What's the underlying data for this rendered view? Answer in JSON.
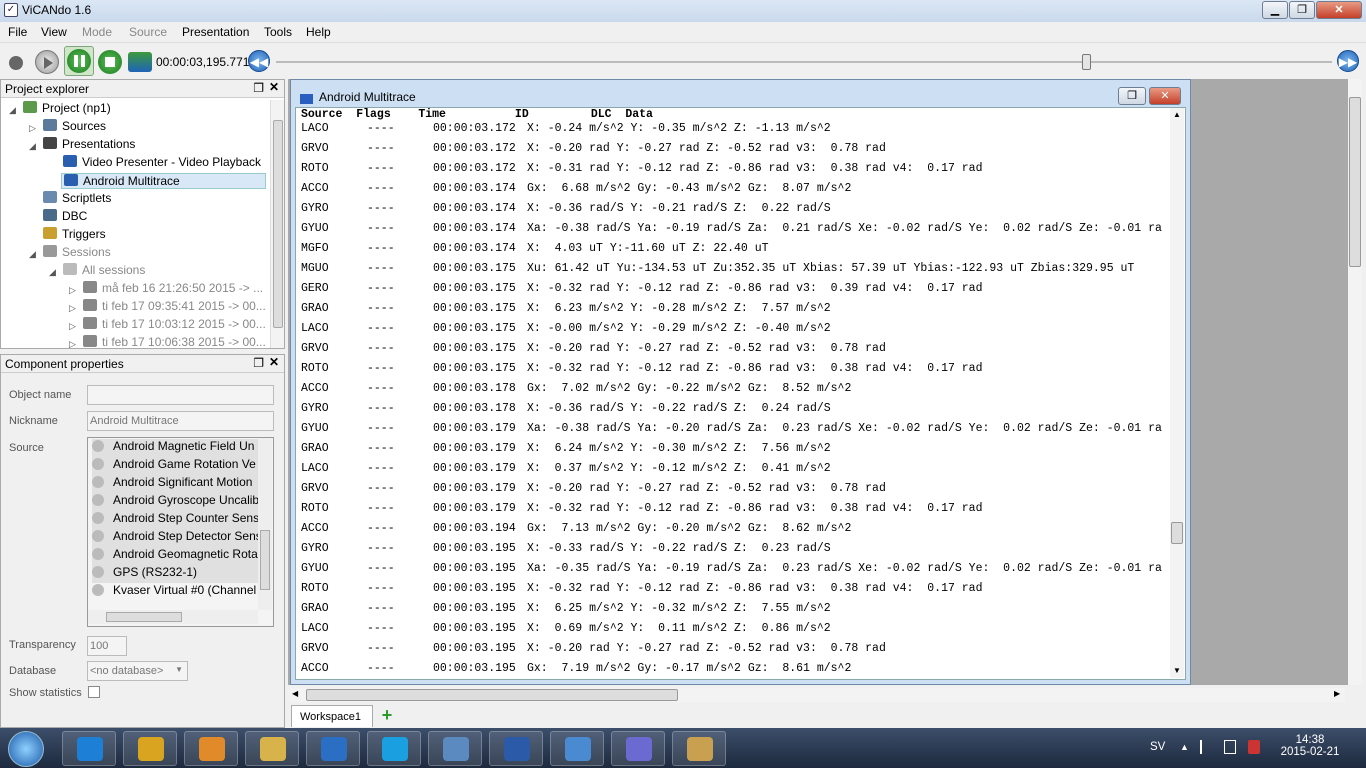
{
  "app": {
    "title": "ViCANdo 1.6"
  },
  "menu": [
    "File",
    "View",
    "Mode",
    "Source",
    "Presentation",
    "Tools",
    "Help"
  ],
  "toolbar": {
    "time": "00:00:03,195.771"
  },
  "project_explorer": {
    "title": "Project explorer",
    "items": [
      {
        "label": "Project (np1)",
        "indent": 0,
        "expander": "◢",
        "color": "#5a9a4a"
      },
      {
        "label": "Sources",
        "indent": 1,
        "expander": "▷",
        "color": "#5c7b9c"
      },
      {
        "label": "Presentations",
        "indent": 1,
        "expander": "◢",
        "color": "#444"
      },
      {
        "label": "Video Presenter - Video Playback",
        "indent": 2,
        "expander": "",
        "color": "#2a5fb0"
      },
      {
        "label": "Android Multitrace",
        "indent": 2,
        "expander": "",
        "color": "#2a5fb0",
        "selected": true
      },
      {
        "label": "Scriptlets",
        "indent": 1,
        "expander": "",
        "color": "#6a8ab0"
      },
      {
        "label": "DBC",
        "indent": 1,
        "expander": "",
        "color": "#4a6a8a"
      },
      {
        "label": "Triggers",
        "indent": 1,
        "expander": "",
        "color": "#c9a030"
      },
      {
        "label": "Sessions",
        "indent": 1,
        "expander": "◢",
        "color": "#999",
        "muted": true
      },
      {
        "label": "All sessions",
        "indent": 2,
        "expander": "◢",
        "color": "#bbb",
        "muted": true
      },
      {
        "label": "må feb 16 21:26:50 2015 -> ...",
        "indent": 3,
        "expander": "▷",
        "color": "#888",
        "muted": true
      },
      {
        "label": "ti feb 17 09:35:41 2015 -> 00...",
        "indent": 3,
        "expander": "▷",
        "color": "#888",
        "muted": true
      },
      {
        "label": "ti feb 17 10:03:12 2015 -> 00...",
        "indent": 3,
        "expander": "▷",
        "color": "#888",
        "muted": true
      },
      {
        "label": "ti feb 17 10:06:38 2015 -> 00...",
        "indent": 3,
        "expander": "▷",
        "color": "#888",
        "muted": true
      }
    ]
  },
  "component_properties": {
    "title": "Component properties",
    "object_name_label": "Object name",
    "object_name_value": "",
    "nickname_label": "Nickname",
    "nickname_value": "Android Multitrace",
    "source_label": "Source",
    "sources": [
      "Android Magnetic Field Un",
      "Android Game Rotation Ve",
      "Android Significant Motion",
      "Android Gyroscope Uncalib",
      "Android Step Counter Sens",
      "Android Step Detector Sens",
      "Android Geomagnetic Rota",
      "GPS (RS232-1)",
      "Kvaser Virtual #0 (Channel 0"
    ],
    "transparency_label": "Transparency",
    "transparency_value": "100",
    "database_label": "Database",
    "database_value": "<no database>",
    "show_statistics_label": "Show statistics"
  },
  "multitrace": {
    "title": "Android Multitrace",
    "header": "Source  Flags    Time          ID         DLC  Data",
    "rows": [
      [
        "LACO",
        "----",
        "00:00:03.172",
        "X: -0.24 m/s^2 Y: -0.35 m/s^2 Z: -1.13 m/s^2"
      ],
      [
        "GRVO",
        "----",
        "00:00:03.172",
        "X: -0.20 rad Y: -0.27 rad Z: -0.52 rad v3:  0.78 rad"
      ],
      [
        "ROTO",
        "----",
        "00:00:03.172",
        "X: -0.31 rad Y: -0.12 rad Z: -0.86 rad v3:  0.38 rad v4:  0.17 rad"
      ],
      [
        "ACCO",
        "----",
        "00:00:03.174",
        "Gx:  6.68 m/s^2 Gy: -0.43 m/s^2 Gz:  8.07 m/s^2"
      ],
      [
        "GYRO",
        "----",
        "00:00:03.174",
        "X: -0.36 rad/S Y: -0.21 rad/S Z:  0.22 rad/S"
      ],
      [
        "GYUO",
        "----",
        "00:00:03.174",
        "Xa: -0.38 rad/S Ya: -0.19 rad/S Za:  0.21 rad/S Xe: -0.02 rad/S Ye:  0.02 rad/S Ze: -0.01 ra"
      ],
      [
        "MGFO",
        "----",
        "00:00:03.174",
        "X:  4.03 uT Y:-11.60 uT Z: 22.40 uT"
      ],
      [
        "MGUO",
        "----",
        "00:00:03.175",
        "Xu: 61.42 uT Yu:-134.53 uT Zu:352.35 uT Xbias: 57.39 uT Ybias:-122.93 uT Zbias:329.95 uT"
      ],
      [
        "GERO",
        "----",
        "00:00:03.175",
        "X: -0.32 rad Y: -0.12 rad Z: -0.86 rad v3:  0.39 rad v4:  0.17 rad"
      ],
      [
        "GRAO",
        "----",
        "00:00:03.175",
        "X:  6.23 m/s^2 Y: -0.28 m/s^2 Z:  7.57 m/s^2"
      ],
      [
        "LACO",
        "----",
        "00:00:03.175",
        "X: -0.00 m/s^2 Y: -0.29 m/s^2 Z: -0.40 m/s^2"
      ],
      [
        "GRVO",
        "----",
        "00:00:03.175",
        "X: -0.20 rad Y: -0.27 rad Z: -0.52 rad v3:  0.78 rad"
      ],
      [
        "ROTO",
        "----",
        "00:00:03.175",
        "X: -0.32 rad Y: -0.12 rad Z: -0.86 rad v3:  0.38 rad v4:  0.17 rad"
      ],
      [
        "ACCO",
        "----",
        "00:00:03.178",
        "Gx:  7.02 m/s^2 Gy: -0.22 m/s^2 Gz:  8.52 m/s^2"
      ],
      [
        "GYRO",
        "----",
        "00:00:03.178",
        "X: -0.36 rad/S Y: -0.22 rad/S Z:  0.24 rad/S"
      ],
      [
        "GYUO",
        "----",
        "00:00:03.179",
        "Xa: -0.38 rad/S Ya: -0.20 rad/S Za:  0.23 rad/S Xe: -0.02 rad/S Ye:  0.02 rad/S Ze: -0.01 ra"
      ],
      [
        "GRAO",
        "----",
        "00:00:03.179",
        "X:  6.24 m/s^2 Y: -0.30 m/s^2 Z:  7.56 m/s^2"
      ],
      [
        "LACO",
        "----",
        "00:00:03.179",
        "X:  0.37 m/s^2 Y: -0.12 m/s^2 Z:  0.41 m/s^2"
      ],
      [
        "GRVO",
        "----",
        "00:00:03.179",
        "X: -0.20 rad Y: -0.27 rad Z: -0.52 rad v3:  0.78 rad"
      ],
      [
        "ROTO",
        "----",
        "00:00:03.179",
        "X: -0.32 rad Y: -0.12 rad Z: -0.86 rad v3:  0.38 rad v4:  0.17 rad"
      ],
      [
        "ACCO",
        "----",
        "00:00:03.194",
        "Gx:  7.13 m/s^2 Gy: -0.20 m/s^2 Gz:  8.62 m/s^2"
      ],
      [
        "GYRO",
        "----",
        "00:00:03.195",
        "X: -0.33 rad/S Y: -0.22 rad/S Z:  0.23 rad/S"
      ],
      [
        "GYUO",
        "----",
        "00:00:03.195",
        "Xa: -0.35 rad/S Ya: -0.19 rad/S Za:  0.23 rad/S Xe: -0.02 rad/S Ye:  0.02 rad/S Ze: -0.01 ra"
      ],
      [
        "ROTO",
        "----",
        "00:00:03.195",
        "X: -0.32 rad Y: -0.12 rad Z: -0.86 rad v3:  0.38 rad v4:  0.17 rad"
      ],
      [
        "GRAO",
        "----",
        "00:00:03.195",
        "X:  6.25 m/s^2 Y: -0.32 m/s^2 Z:  7.55 m/s^2"
      ],
      [
        "LACO",
        "----",
        "00:00:03.195",
        "X:  0.69 m/s^2 Y:  0.11 m/s^2 Z:  0.86 m/s^2"
      ],
      [
        "GRVO",
        "----",
        "00:00:03.195",
        "X: -0.20 rad Y: -0.27 rad Z: -0.52 rad v3:  0.78 rad"
      ],
      [
        "ACCO",
        "----",
        "00:00:03.195",
        "Gx:  7.19 m/s^2 Gy: -0.17 m/s^2 Gz:  8.61 m/s^2"
      ]
    ]
  },
  "workspace_tab": "Workspace1",
  "taskbar": {
    "apps": [
      {
        "name": "ie-icon",
        "color": "#1e7fd6"
      },
      {
        "name": "chrome-icon",
        "color": "#d9a520"
      },
      {
        "name": "media-icon",
        "color": "#e08a2a"
      },
      {
        "name": "explorer-icon",
        "color": "#d8b24a"
      },
      {
        "name": "lync-icon",
        "color": "#2b6fc4"
      },
      {
        "name": "skype-icon",
        "color": "#1aa0e0"
      },
      {
        "name": "photos-icon",
        "color": "#5a8ac0"
      },
      {
        "name": "word-icon",
        "color": "#2a5aa8"
      },
      {
        "name": "remote-icon",
        "color": "#4a8ad0"
      },
      {
        "name": "vicando-icon",
        "color": "#6a6ad0"
      },
      {
        "name": "paint-icon",
        "color": "#c8a050"
      }
    ],
    "lang": "SV",
    "time": "14:38",
    "date": "2015-02-21"
  }
}
